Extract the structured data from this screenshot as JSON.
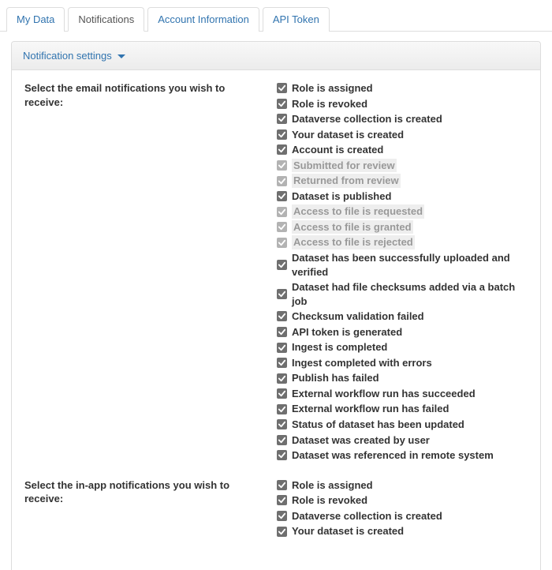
{
  "tabs": [
    {
      "label": "My Data"
    },
    {
      "label": "Notifications"
    },
    {
      "label": "Account Information"
    },
    {
      "label": "API Token"
    }
  ],
  "active_tab_index": 1,
  "panel_title": "Notification settings",
  "sections": {
    "email": {
      "label": "Select the email notifications you wish to receive:",
      "options": [
        {
          "label": "Role is assigned",
          "checked": true
        },
        {
          "label": "Role is revoked",
          "checked": true
        },
        {
          "label": "Dataverse collection is created",
          "checked": true
        },
        {
          "label": "Your dataset is created",
          "checked": true
        },
        {
          "label": "Account is created",
          "checked": true
        },
        {
          "label": "Submitted for review",
          "checked": true,
          "disabled": true
        },
        {
          "label": "Returned from review",
          "checked": true,
          "disabled": true
        },
        {
          "label": "Dataset is published",
          "checked": true
        },
        {
          "label": "Access to file is requested",
          "checked": true,
          "disabled": true
        },
        {
          "label": "Access to file is granted",
          "checked": true,
          "disabled": true
        },
        {
          "label": "Access to file is rejected",
          "checked": true,
          "disabled": true
        },
        {
          "label": "Dataset has been successfully uploaded and verified",
          "checked": true
        },
        {
          "label": "Dataset had file checksums added via a batch job",
          "checked": true
        },
        {
          "label": "Checksum validation failed",
          "checked": true
        },
        {
          "label": "API token is generated",
          "checked": true
        },
        {
          "label": "Ingest is completed",
          "checked": true
        },
        {
          "label": "Ingest completed with errors",
          "checked": true
        },
        {
          "label": "Publish has failed",
          "checked": true
        },
        {
          "label": "External workflow run has succeeded",
          "checked": true
        },
        {
          "label": "External workflow run has failed",
          "checked": true
        },
        {
          "label": "Status of dataset has been updated",
          "checked": true
        },
        {
          "label": "Dataset was created by user",
          "checked": true
        },
        {
          "label": "Dataset was referenced in remote system",
          "checked": true
        }
      ]
    },
    "inapp": {
      "label": "Select the in-app notifications you wish to receive:",
      "options": [
        {
          "label": "Role is assigned",
          "checked": true
        },
        {
          "label": "Role is revoked",
          "checked": true
        },
        {
          "label": "Dataverse collection is created",
          "checked": true
        },
        {
          "label": "Your dataset is created",
          "checked": true
        }
      ]
    }
  }
}
